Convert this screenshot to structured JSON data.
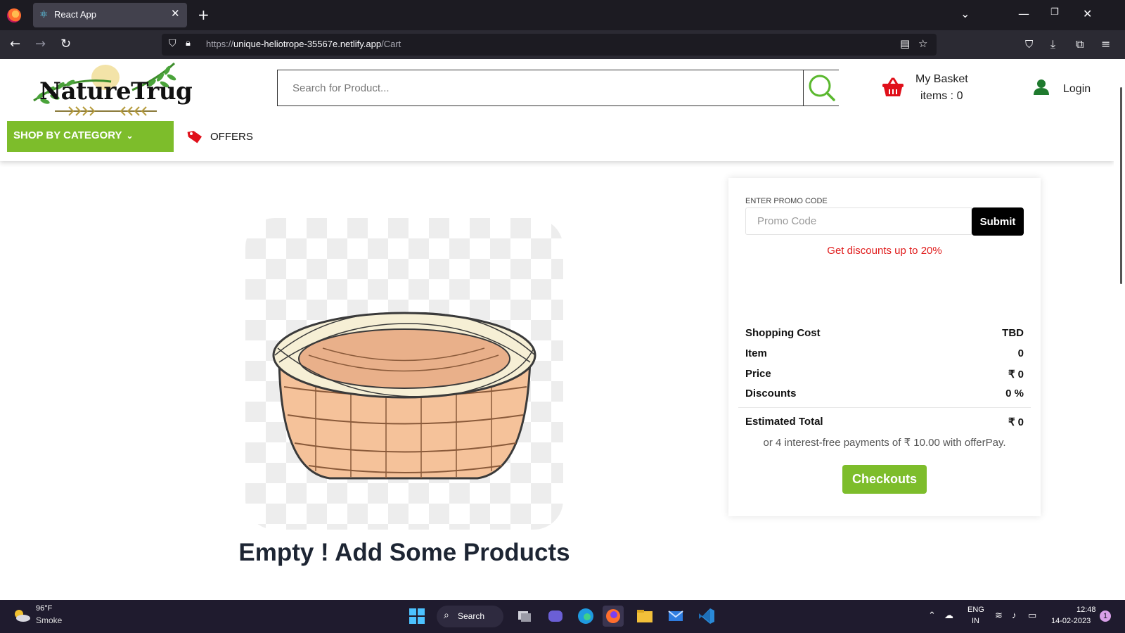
{
  "browser": {
    "tab_title": "React App",
    "url_prefix": "https://",
    "url_host": "unique-heliotrope-35567e.netlify.app",
    "url_path": "/Cart"
  },
  "header": {
    "logo_text": "NatureTrug",
    "search_placeholder": "Search for Product...",
    "basket_label": "My Basket",
    "basket_items": "items : 0",
    "login_label": "Login",
    "category_label": "SHOP BY CATEGORY",
    "offers_label": "OFFERS"
  },
  "main": {
    "empty_message": "Empty ! Add Some Products"
  },
  "summary": {
    "promo_label": "ENTER PROMO CODE",
    "promo_placeholder": "Promo Code",
    "submit_label": "Submit",
    "promo_note": "Get discounts up to 20%",
    "rows": [
      {
        "label": "Shopping Cost",
        "value": "TBD"
      },
      {
        "label": "Item",
        "value": "0"
      },
      {
        "label": "Price",
        "value": "₹ 0"
      },
      {
        "label": "Discounts",
        "value": "0 %"
      }
    ],
    "total_label": "Estimated Total",
    "total_value": "₹ 0",
    "offerpay_text": "or 4 interest-free payments of ₹ 10.00 with offerPay.",
    "checkout_label": "Checkouts"
  },
  "taskbar": {
    "weather_temp": "96°F",
    "weather_desc": "Smoke",
    "search_label": "Search",
    "lang_1": "ENG",
    "lang_2": "IN",
    "time": "12:48",
    "date": "14-02-2023",
    "notif_count": "1"
  },
  "colors": {
    "accent_green": "#7dbd2b",
    "promo_red": "#e01b1b",
    "basket_red": "#e0101a"
  }
}
